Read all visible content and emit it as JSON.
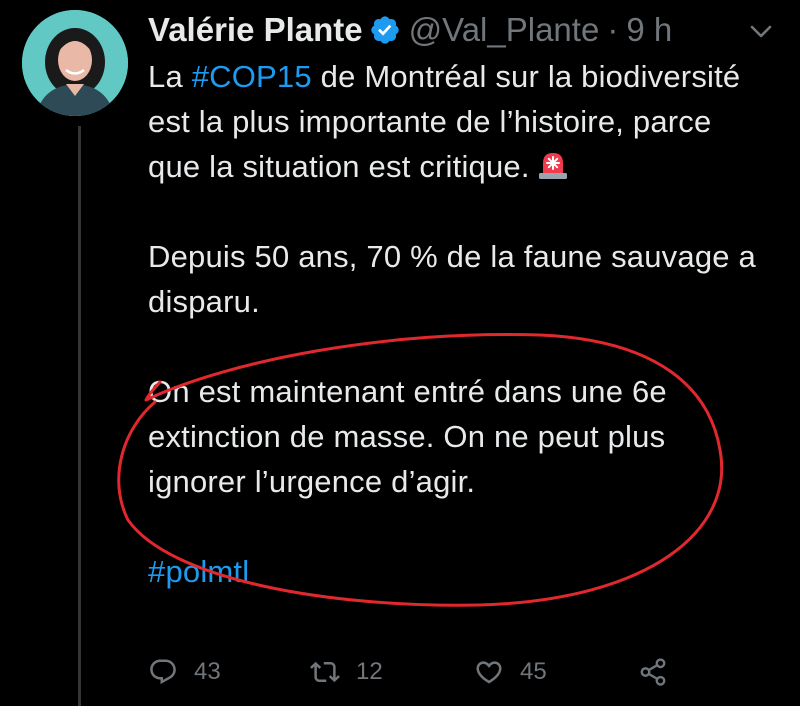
{
  "tweet": {
    "author_name": "Valérie Plante",
    "author_handle": "@Val_Plante",
    "separator": "·",
    "time_ago": "9 h",
    "hashtag_cop15": "#COP15",
    "p1_prefix": "La ",
    "p1_rest": " de Montréal sur la biodiversité est la plus importante de l’histoire, parce que la situation est critique.",
    "p2": "Depuis 50 ans, 70 % de la faune sauvage a disparu.",
    "p3": "On est maintenant entré dans une 6e extinction de masse. On ne peut plus ignorer l’urgence d’agir.",
    "hashtag_polmtl": "#polmtl"
  },
  "actions": {
    "replies": "43",
    "retweets": "12",
    "likes": "45"
  },
  "colors": {
    "background": "#000000",
    "link": "#1d9bf0",
    "muted": "#71767b",
    "verified": "#1d9bf0",
    "annotation": "#e0282e"
  },
  "icons": {
    "verified": "verified-badge-icon",
    "more": "more-options-icon",
    "siren": "police-siren-emoji",
    "reply": "reply-icon",
    "retweet": "retweet-icon",
    "like": "heart-icon",
    "share": "share-icon"
  }
}
